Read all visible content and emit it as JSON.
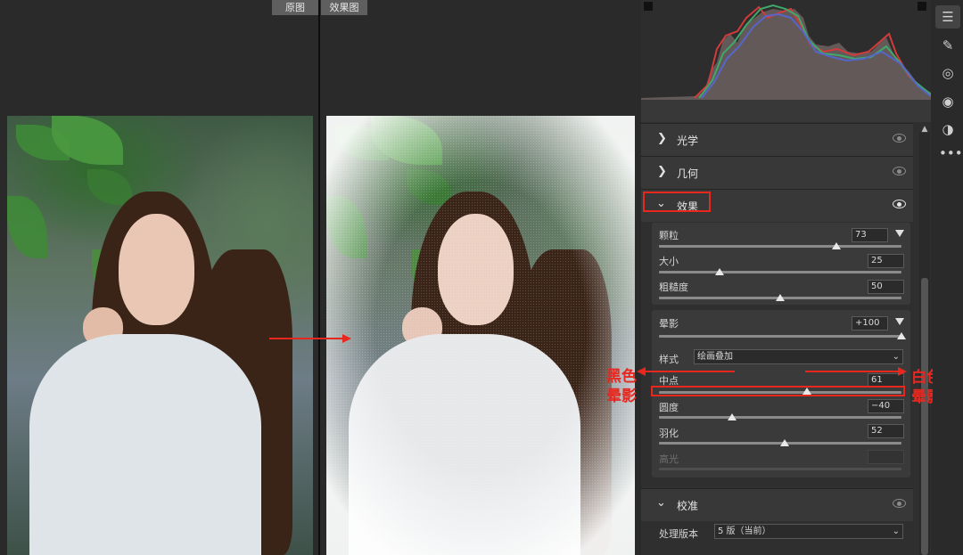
{
  "compare": {
    "original_tab": "原图",
    "effect_tab": "效果图"
  },
  "annotations": {
    "black_vignette": "黑色\n晕影",
    "white_vignette": "白色\n晕影",
    "color": "#e8271f"
  },
  "panel": {
    "sections": {
      "optics": "光学",
      "geometry": "几何",
      "effects": "效果",
      "calibration": "校准"
    },
    "grain": {
      "amount_label": "颗粒",
      "amount_value": "73",
      "amount_level": 0.73,
      "size_label": "大小",
      "size_value": "25",
      "size_level": 0.25,
      "roughness_label": "粗糙度",
      "roughness_value": "50",
      "roughness_level": 0.5
    },
    "vignette": {
      "amount_label": "晕影",
      "amount_value": "+100",
      "amount_level": 1.0,
      "style_label": "样式",
      "style_value": "绘画叠加",
      "midpoint_label": "中点",
      "midpoint_value": "61",
      "midpoint_level": 0.61,
      "roundness_label": "圆度",
      "roundness_value": "−40",
      "roundness_level": 0.3,
      "feather_label": "羽化",
      "feather_value": "52",
      "feather_level": 0.52,
      "highlights_label": "高光",
      "highlights_value": ""
    },
    "calibration": {
      "process_label": "处理版本",
      "process_value": "5 版（当前）"
    }
  },
  "toolstrip": {
    "icons": [
      "sliders-icon",
      "healing-icon",
      "mask-icon",
      "red-eye-icon",
      "presets-icon",
      "more-icon"
    ]
  }
}
